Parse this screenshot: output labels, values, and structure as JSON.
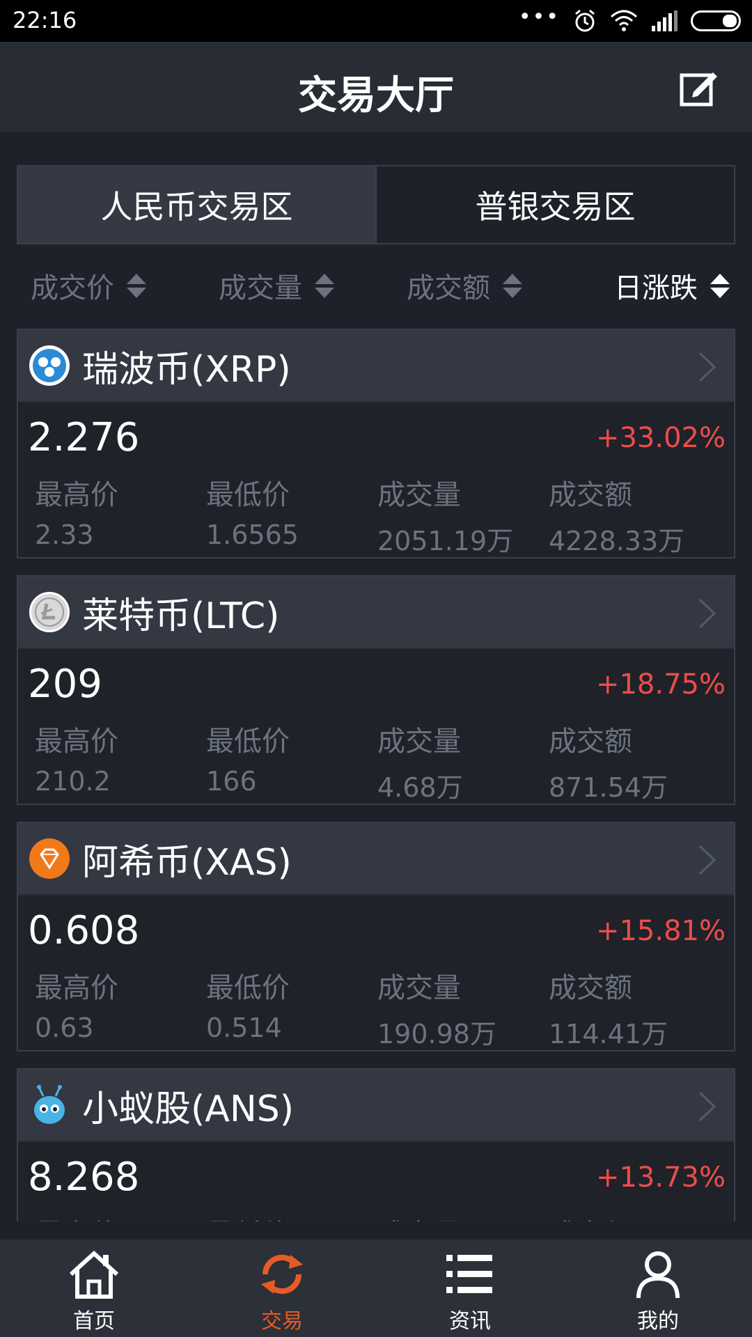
{
  "status": {
    "time": "22:16"
  },
  "header": {
    "title": "交易大厅"
  },
  "tabs": [
    {
      "label": "人民币交易区"
    },
    {
      "label": "普银交易区"
    }
  ],
  "sort": [
    {
      "label": "成交价"
    },
    {
      "label": "成交量"
    },
    {
      "label": "成交额"
    },
    {
      "label": "日涨跌"
    }
  ],
  "stat_labels": {
    "high": "最高价",
    "low": "最低价",
    "volume": "成交量",
    "amount": "成交额"
  },
  "coins": [
    {
      "name": "瑞波币(XRP)",
      "price": "2.276",
      "change": "+33.02%",
      "high": "2.33",
      "low": "1.6565",
      "volume": "2051.19万",
      "amount": "4228.33万",
      "icon": "xrp-icon"
    },
    {
      "name": "莱特币(LTC)",
      "price": "209",
      "change": "+18.75%",
      "high": "210.2",
      "low": "166",
      "volume": "4.68万",
      "amount": "871.54万",
      "icon": "ltc-icon"
    },
    {
      "name": "阿希币(XAS)",
      "price": "0.608",
      "change": "+15.81%",
      "high": "0.63",
      "low": "0.514",
      "volume": "190.98万",
      "amount": "114.41万",
      "icon": "xas-icon"
    },
    {
      "name": "小蚁股(ANS)",
      "price": "8.268",
      "change": "+13.73%",
      "icon": "ans-icon"
    }
  ],
  "nav": [
    {
      "label": "首页",
      "icon": "home-icon"
    },
    {
      "label": "交易",
      "icon": "refresh-icon"
    },
    {
      "label": "资讯",
      "icon": "list-icon"
    },
    {
      "label": "我的",
      "icon": "user-icon"
    }
  ],
  "colors": {
    "accent": "#e95b25",
    "up": "#ee4c4c",
    "background": "#1e2129"
  }
}
